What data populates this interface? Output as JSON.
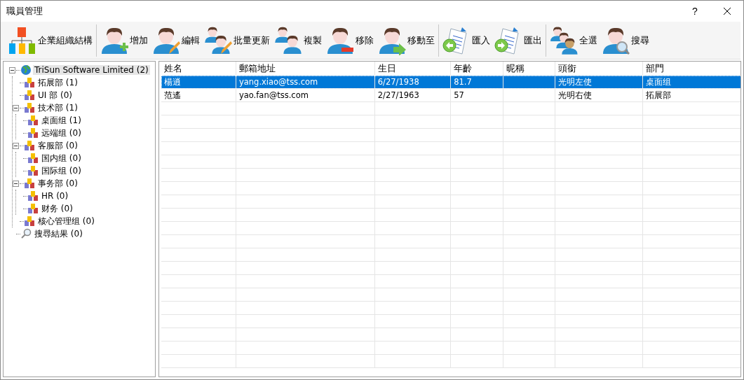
{
  "window": {
    "title": "職員管理",
    "help": "?"
  },
  "toolbar": [
    {
      "items": [
        {
          "kind": "org",
          "label": "企業組織結構"
        }
      ]
    },
    {
      "items": [
        {
          "kind": "add",
          "label": "增加"
        },
        {
          "kind": "edit",
          "label": "編輯"
        },
        {
          "kind": "batch",
          "label": "批量更新"
        },
        {
          "kind": "copy",
          "label": "複製"
        },
        {
          "kind": "remove",
          "label": "移除"
        },
        {
          "kind": "move",
          "label": "移動至"
        }
      ]
    },
    {
      "items": [
        {
          "kind": "import",
          "label": "匯入"
        },
        {
          "kind": "export",
          "label": "匯出"
        }
      ]
    },
    {
      "items": [
        {
          "kind": "selectall",
          "label": "全選"
        },
        {
          "kind": "search",
          "label": "搜尋"
        }
      ]
    }
  ],
  "tree": [
    {
      "kind": "globe",
      "label": "TriSun Software Limited (2)",
      "selected": true,
      "expanded": true,
      "children": [
        {
          "kind": "group",
          "label": "拓展部 (1)",
          "selected": false
        },
        {
          "kind": "group",
          "label": "UI 部 (0)",
          "selected": false
        },
        {
          "kind": "group",
          "label": "技术部 (1)",
          "selected": false,
          "expanded": true,
          "children": [
            {
              "kind": "group",
              "label": "桌面组 (1)",
              "selected": false
            },
            {
              "kind": "group",
              "label": "远端组 (0)",
              "selected": false
            }
          ]
        },
        {
          "kind": "group",
          "label": "客服部 (0)",
          "selected": false,
          "expanded": true,
          "children": [
            {
              "kind": "group",
              "label": "国内组 (0)",
              "selected": false
            },
            {
              "kind": "group",
              "label": "国际组 (0)",
              "selected": false
            }
          ]
        },
        {
          "kind": "group",
          "label": "事务部 (0)",
          "selected": false,
          "expanded": true,
          "children": [
            {
              "kind": "group",
              "label": "HR (0)",
              "selected": false
            },
            {
              "kind": "group",
              "label": "财务 (0)",
              "selected": false
            }
          ]
        },
        {
          "kind": "group",
          "label": "核心管理组 (0)",
          "selected": false
        }
      ]
    },
    {
      "kind": "search",
      "label": "搜尋結果 (0)",
      "selected": false
    }
  ],
  "table": {
    "columns": [
      "姓名",
      "郵箱地址",
      "生日",
      "年齡",
      "昵稱",
      "頭銜",
      "部門"
    ],
    "rows": [
      {
        "selected": true,
        "cells": [
          "楊逍",
          "yang.xiao@tss.com",
          "6/27/1938",
          "81.7",
          "",
          "光明左使",
          "桌面组"
        ]
      },
      {
        "selected": false,
        "cells": [
          "范遙",
          "yao.fan@tss.com",
          "2/27/1963",
          "57",
          "",
          "光明右使",
          "拓展部"
        ]
      }
    ]
  }
}
